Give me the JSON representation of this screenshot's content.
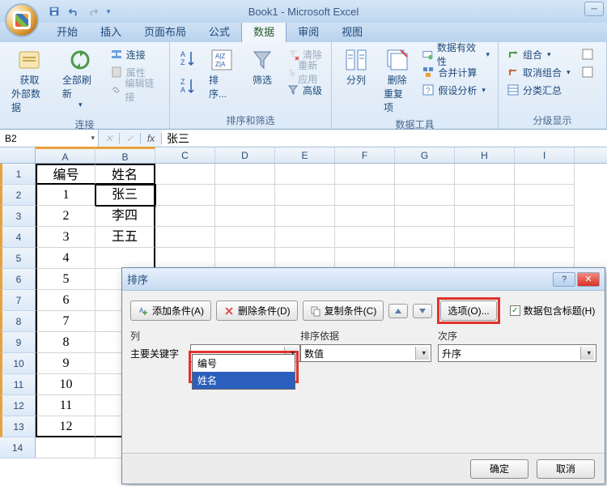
{
  "app": {
    "title": "Book1 - Microsoft Excel"
  },
  "tabs": [
    "开始",
    "插入",
    "页面布局",
    "公式",
    "数据",
    "审阅",
    "视图"
  ],
  "active_tab": "数据",
  "ribbon": {
    "groups": [
      {
        "label": "连接",
        "buttons_large": [
          {
            "name": "external-data",
            "line1": "获取",
            "line2": "外部数据"
          },
          {
            "name": "refresh-all",
            "line1": "全部刷新",
            "line2": ""
          }
        ],
        "buttons_small": [
          {
            "name": "connections",
            "label": "连接"
          },
          {
            "name": "properties",
            "label": "属性",
            "dim": true
          },
          {
            "name": "edit-links",
            "label": "编辑链接",
            "dim": true
          }
        ]
      },
      {
        "label": "排序和筛选",
        "buttons_large": [
          {
            "name": "sort-asc",
            "label": ""
          },
          {
            "name": "sort",
            "label": "排序..."
          },
          {
            "name": "filter",
            "label": "筛选"
          }
        ],
        "buttons_small": [
          {
            "name": "clear",
            "label": "清除",
            "dim": true
          },
          {
            "name": "reapply",
            "label": "重新应用",
            "dim": true
          },
          {
            "name": "advanced",
            "label": "高级"
          }
        ]
      },
      {
        "label": "数据工具",
        "buttons_large": [
          {
            "name": "text-to-columns",
            "label": "分列"
          },
          {
            "name": "remove-duplicates",
            "line1": "删除",
            "line2": "重复项"
          }
        ],
        "buttons_small": [
          {
            "name": "data-validation",
            "label": "数据有效性"
          },
          {
            "name": "consolidate",
            "label": "合并计算"
          },
          {
            "name": "what-if",
            "label": "假设分析"
          }
        ]
      },
      {
        "label": "分级显示",
        "buttons_small": [
          {
            "name": "group",
            "label": "组合"
          },
          {
            "name": "ungroup",
            "label": "取消组合"
          },
          {
            "name": "subtotal",
            "label": "分类汇总"
          }
        ]
      }
    ]
  },
  "formula_bar": {
    "name_box": "B2",
    "value": "张三"
  },
  "columns": [
    "A",
    "B",
    "C",
    "D",
    "E",
    "F",
    "G",
    "H",
    "I"
  ],
  "sheet": {
    "header_row": {
      "A": "编号",
      "B": "姓名"
    },
    "data": [
      {
        "A": "1",
        "B": "张三"
      },
      {
        "A": "2",
        "B": "李四"
      },
      {
        "A": "3",
        "B": "王五"
      },
      {
        "A": "4",
        "B": ""
      },
      {
        "A": "5",
        "B": ""
      },
      {
        "A": "6",
        "B": ""
      },
      {
        "A": "7",
        "B": ""
      },
      {
        "A": "8",
        "B": ""
      },
      {
        "A": "9",
        "B": ""
      },
      {
        "A": "10",
        "B": ""
      },
      {
        "A": "11",
        "B": ""
      },
      {
        "A": "12",
        "B": ""
      }
    ]
  },
  "dialog": {
    "title": "排序",
    "toolbar": {
      "add": "添加条件(A)",
      "delete": "删除条件(D)",
      "copy": "复制条件(C)",
      "options": "选项(O)...",
      "has_header": "数据包含标题(H)"
    },
    "headers": {
      "col": "列",
      "basis": "排序依据",
      "order": "次序"
    },
    "row": {
      "key_label": "主要关键字",
      "key_value": "",
      "basis_value": "数值",
      "order_value": "升序"
    },
    "dropdown": {
      "items": [
        "编号",
        "姓名"
      ],
      "highlighted": "姓名"
    },
    "buttons": {
      "ok": "确定",
      "cancel": "取消"
    }
  }
}
